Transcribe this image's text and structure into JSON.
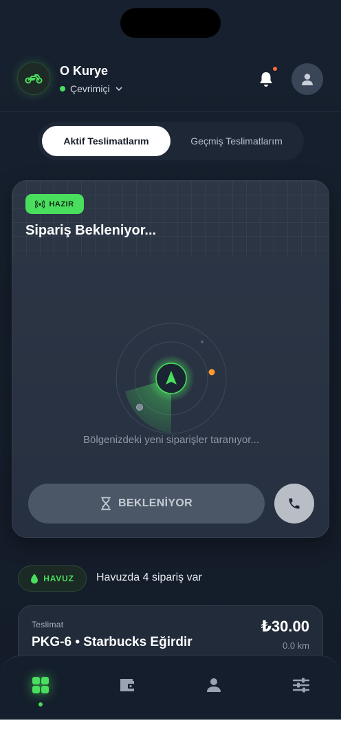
{
  "header": {
    "title": "O Kurye",
    "status": "Çevrimiçi"
  },
  "tabs": [
    {
      "label": "Aktif Teslimatlarım",
      "active": true
    },
    {
      "label": "Geçmiş Teslimatlarım",
      "active": false
    }
  ],
  "main_card": {
    "badge": "HAZIR",
    "title": "Sipariş Bekleniyor...",
    "scan_text": "Bölgenizdeki yeni siparişler taranıyor...",
    "wait_button": "BEKLENİYOR"
  },
  "pool": {
    "badge": "HAVUZ",
    "text": "Havuzda 4 sipariş var"
  },
  "delivery": {
    "label": "Teslimat",
    "title": "PKG-6 • Starbucks Eğirdir",
    "price": "₺30.00",
    "distance": "0.0 km"
  },
  "bottom_nav": {
    "items": [
      "grid-icon",
      "wallet-icon",
      "person-icon",
      "sliders-icon"
    ],
    "active": "grid-icon"
  },
  "colors": {
    "accent": "#4ade5e",
    "background": "#141d2b",
    "card": "#2a3443",
    "notification": "#ff6a3a",
    "radar_marker": "#ff9a2e"
  }
}
